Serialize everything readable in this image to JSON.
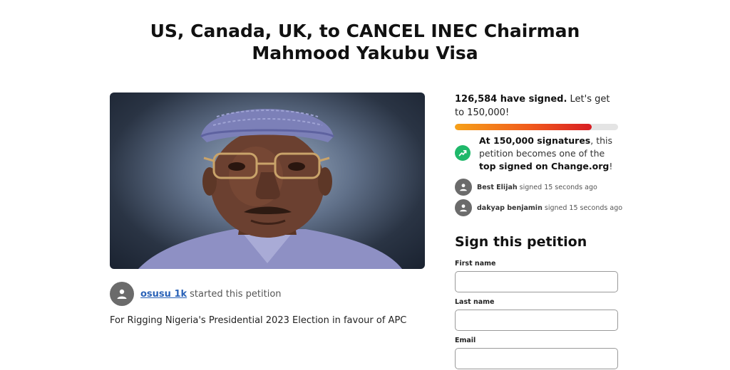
{
  "page": {
    "title": "US, Canada, UK, to CANCEL INEC Chairman Mahmood Yakubu Visa"
  },
  "petition": {
    "author_name": "osusu 1k",
    "author_action": "started this petition",
    "description": "For Rigging Nigeria's Presidential 2023 Election in favour of APC"
  },
  "progress": {
    "signed_count": "126,584 have signed.",
    "goal_text": "Let's get to 150,000!",
    "signed": 126584,
    "goal": 150000,
    "fraction": 0.84,
    "milestone_bold": "At 150,000 signatures",
    "milestone_mid": ", this petition becomes one of the ",
    "milestone_bold2": "top signed on Change.org",
    "milestone_end": "!",
    "colors": {
      "fill_start": "#f6a11a",
      "fill_end": "#d81d23",
      "badge": "#1fb86a"
    }
  },
  "activity": [
    {
      "name": "Best Elijah",
      "action": "signed 15 seconds ago"
    },
    {
      "name": "dakyap benjamin",
      "action": "signed 15 seconds ago"
    }
  ],
  "form": {
    "heading": "Sign this petition",
    "first_name_label": "First name",
    "last_name_label": "Last name",
    "email_label": "Email",
    "first_name_value": "",
    "last_name_value": "",
    "email_value": ""
  },
  "colors": {
    "link": "#2b63b8",
    "avatar": "#6b6b6b"
  }
}
